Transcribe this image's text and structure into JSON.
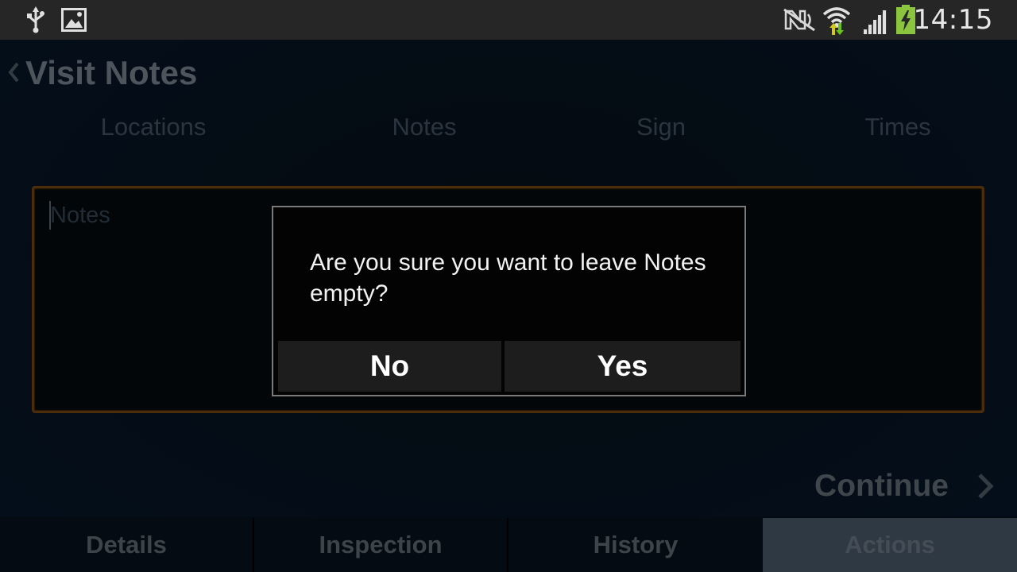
{
  "status_bar": {
    "time": "14:15",
    "left_icons": [
      "usb-icon",
      "image-icon"
    ],
    "right_icons": [
      "nfc-icon",
      "wifi-icon",
      "signal-icon",
      "battery-charging-icon"
    ]
  },
  "header": {
    "title": "Visit Notes"
  },
  "steps": {
    "items": [
      "Locations",
      "Notes",
      "Sign",
      "Times"
    ]
  },
  "notes_field": {
    "placeholder": "Notes",
    "value": ""
  },
  "continue": {
    "label": "Continue"
  },
  "tabs": {
    "items": [
      "Details",
      "Inspection",
      "History",
      "Actions"
    ],
    "active": "Actions"
  },
  "dialog": {
    "message": "Are you sure you want to leave Notes empty?",
    "buttons": [
      "No",
      "Yes"
    ]
  },
  "colors": {
    "accent_border": "#8a5312",
    "active_tab": "#56697d"
  }
}
